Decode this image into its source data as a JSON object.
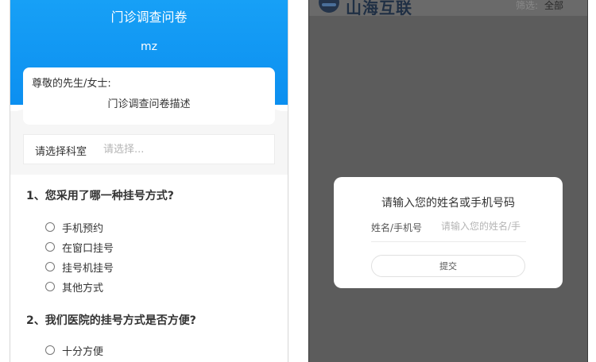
{
  "questionnaire": {
    "title": "门诊调查问卷",
    "subtitle": "mz",
    "greeting": "尊敬的先生/女士:",
    "description": "门诊调查问卷描述",
    "department": {
      "label": "请选择科室",
      "placeholder": "请选择..."
    },
    "questions": [
      {
        "text": "1、您采用了哪一种挂号方式?",
        "options": [
          "手机预约",
          "在窗口挂号",
          "挂号机挂号",
          "其他方式"
        ]
      },
      {
        "text": "2、我们医院的挂号方式是否方便?",
        "options": [
          "十分方便"
        ]
      }
    ]
  },
  "app": {
    "brand": "山海互联",
    "filter": {
      "label": "筛选:",
      "value": "全部"
    }
  },
  "dialog": {
    "title": "请输入您的姓名或手机号码",
    "field_label": "姓名/手机号",
    "field_placeholder": "请输入您的姓名/手",
    "submit_label": "提交"
  },
  "colors": {
    "header_blue": "#0c8ff0",
    "overlay_gray": "#5c5c5c",
    "brand_navy": "#1f2f44"
  }
}
